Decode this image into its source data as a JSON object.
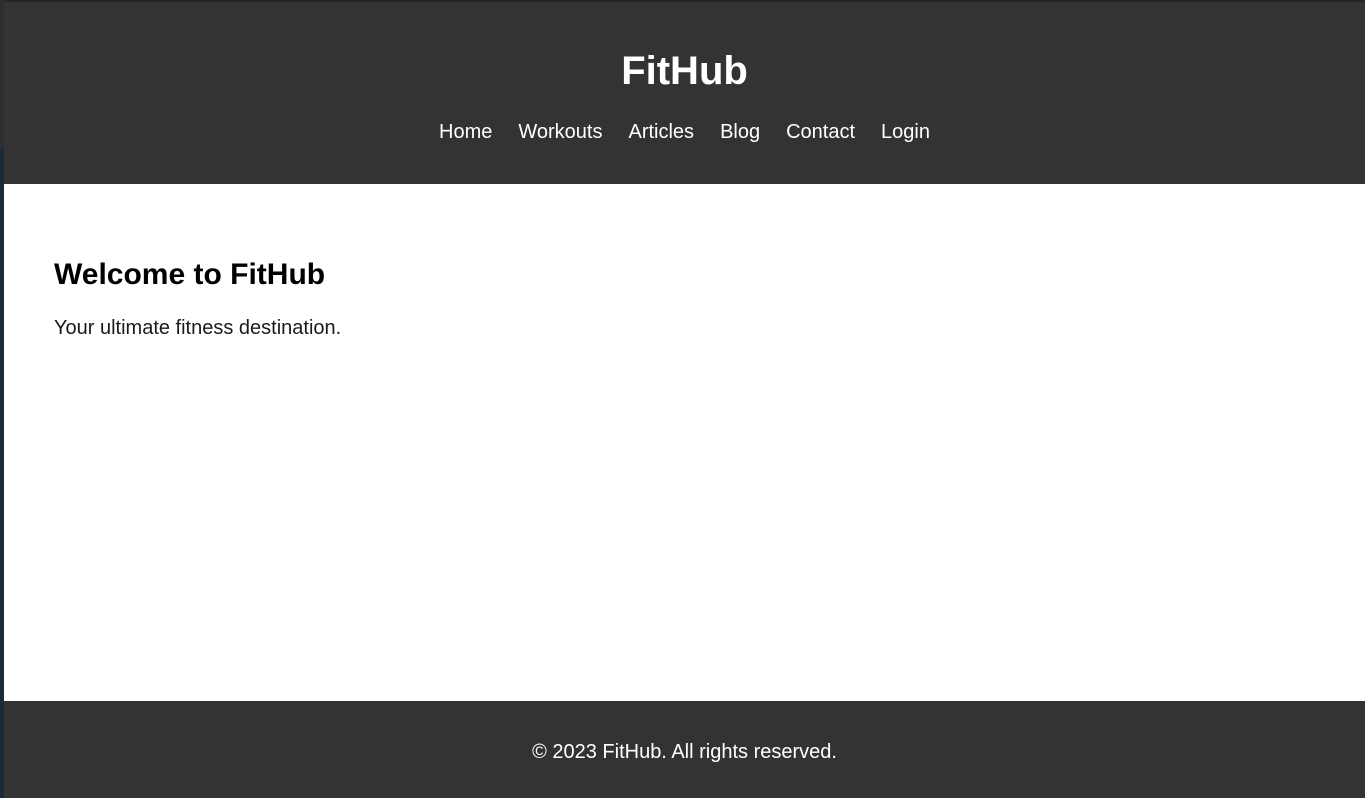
{
  "header": {
    "title": "FitHub",
    "nav": [
      {
        "label": "Home"
      },
      {
        "label": "Workouts"
      },
      {
        "label": "Articles"
      },
      {
        "label": "Blog"
      },
      {
        "label": "Contact"
      },
      {
        "label": "Login"
      }
    ]
  },
  "main": {
    "heading": "Welcome to FitHub",
    "tagline": "Your ultimate fitness destination."
  },
  "footer": {
    "copyright": "© 2023 FitHub. All rights reserved."
  },
  "colors": {
    "header_bg": "#333333",
    "footer_bg": "#333333",
    "page_bg": "#ffffff",
    "text_light": "#ffffff"
  }
}
